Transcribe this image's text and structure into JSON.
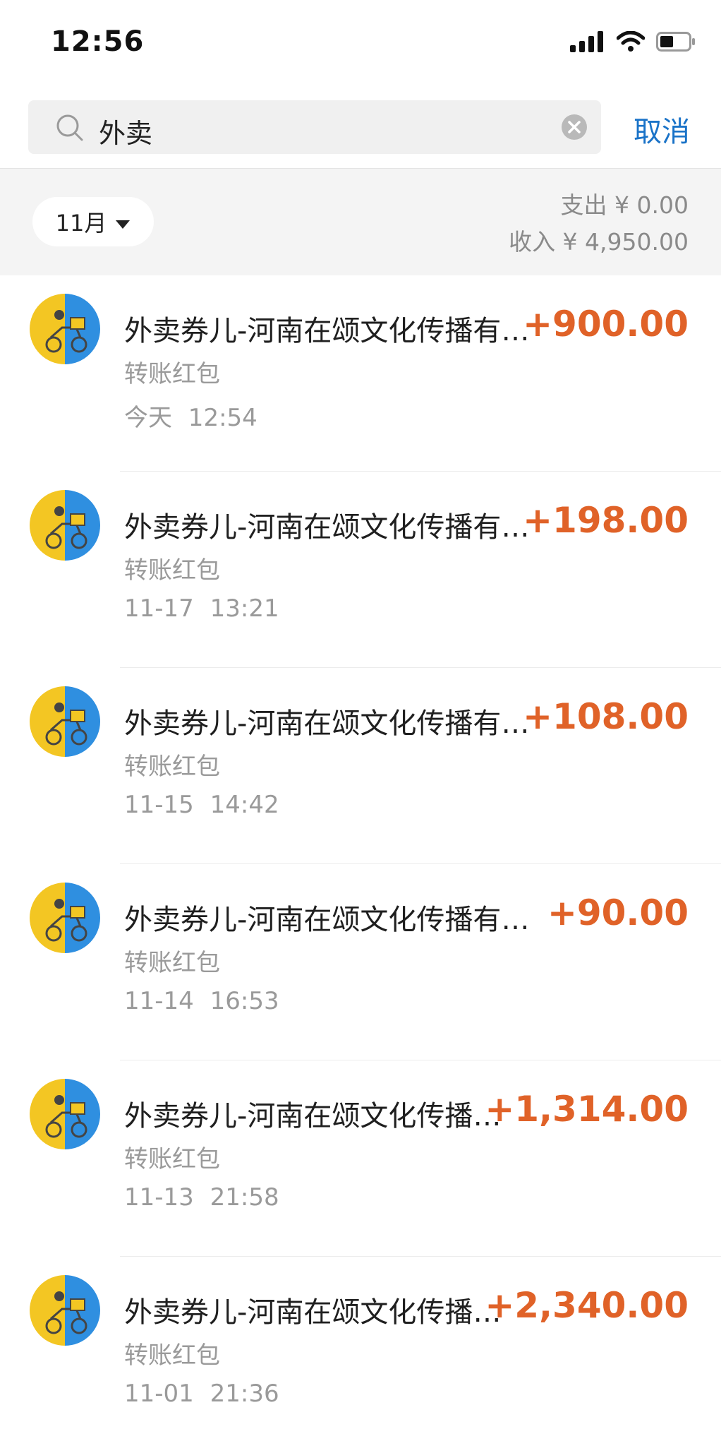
{
  "status_bar": {
    "time": "12:56"
  },
  "search": {
    "query": "外卖",
    "cancel_label": "取消"
  },
  "summary": {
    "month_label": "11月",
    "expense": "支出 ¥ 0.00",
    "income": "收入 ¥ 4,950.00"
  },
  "transactions": [
    {
      "title": "外卖券儿-河南在颂文化传播有限公司",
      "type": "转账红包",
      "time": "今天  12:54",
      "amount": "+900.00"
    },
    {
      "title": "外卖券儿-河南在颂文化传播有限公司",
      "type": "转账红包",
      "time": "11-17  13:21",
      "amount": "+198.00"
    },
    {
      "title": "外卖券儿-河南在颂文化传播有限公司",
      "type": "转账红包",
      "time": "11-15  14:42",
      "amount": "+108.00"
    },
    {
      "title": "外卖券儿-河南在颂文化传播有限公司",
      "type": "转账红包",
      "time": "11-14  16:53",
      "amount": "+90.00"
    },
    {
      "title": "外卖券儿-河南在颂文化传播有限公司",
      "type": "转账红包",
      "time": "11-13  21:58",
      "amount": "+1,314.00"
    },
    {
      "title": "外卖券儿-河南在颂文化传播有限公司",
      "type": "转账红包",
      "time": "11-01  21:36",
      "amount": "+2,340.00"
    }
  ],
  "colors": {
    "accent": "#1a73c8",
    "income": "#e06228",
    "avatar_yellow": "#f3c623",
    "avatar_blue": "#2f8fe0"
  },
  "icons": {
    "signal": "cellular-signal-icon",
    "wifi": "wifi-icon",
    "battery": "battery-icon",
    "search": "search-icon",
    "clear": "clear-icon",
    "dropdown": "caret-down-icon"
  }
}
